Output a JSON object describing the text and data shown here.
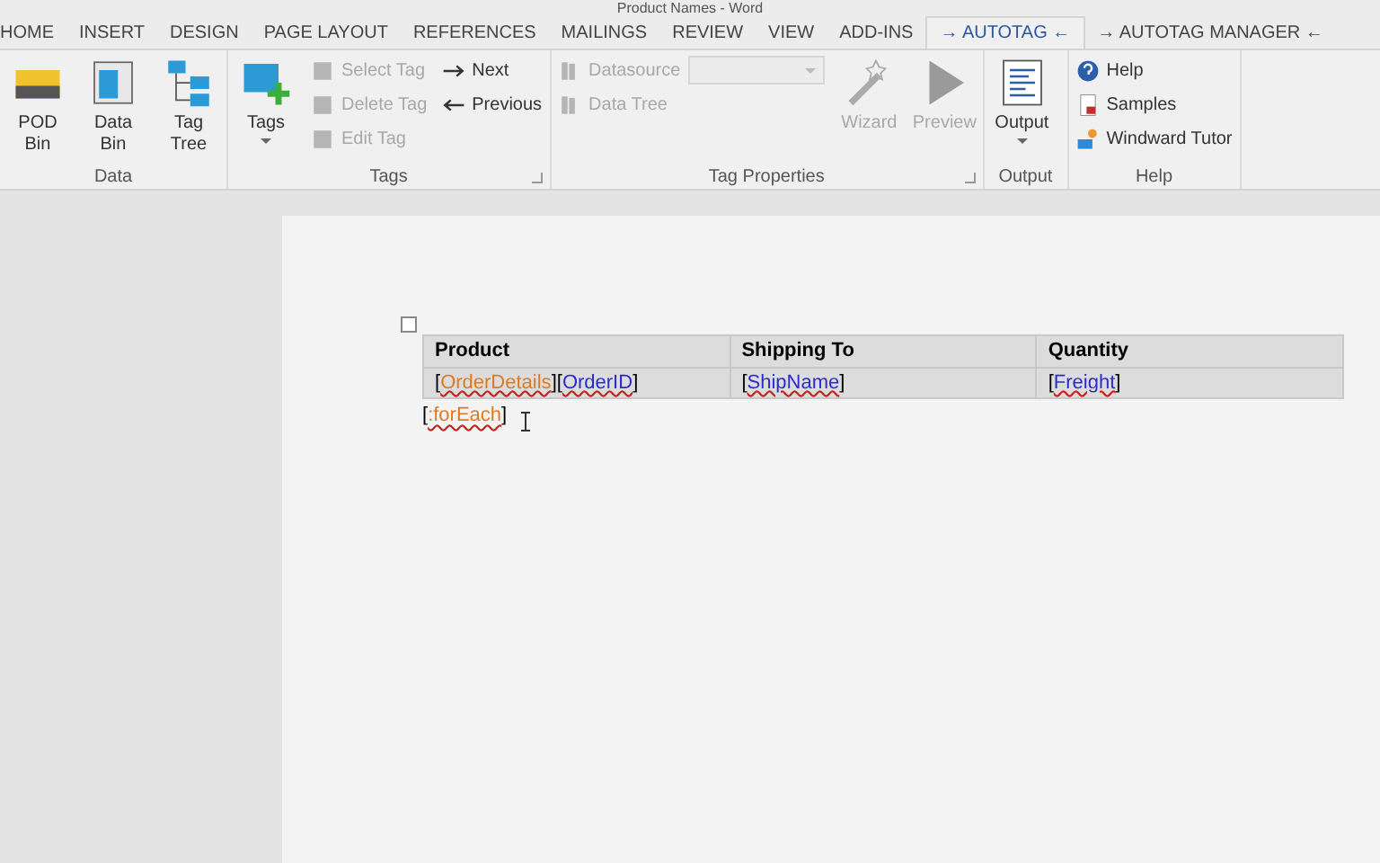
{
  "window": {
    "title": "Product Names - Word"
  },
  "tabs": [
    {
      "label": "HOME",
      "selected": false
    },
    {
      "label": "INSERT",
      "selected": false
    },
    {
      "label": "DESIGN",
      "selected": false
    },
    {
      "label": "PAGE LAYOUT",
      "selected": false
    },
    {
      "label": "REFERENCES",
      "selected": false
    },
    {
      "label": "MAILINGS",
      "selected": false
    },
    {
      "label": "REVIEW",
      "selected": false
    },
    {
      "label": "VIEW",
      "selected": false
    },
    {
      "label": "ADD-INS",
      "selected": false
    },
    {
      "label": "→ AUTOTAG ←",
      "selected": true
    },
    {
      "label": "→ AUTOTAG MANAGER ←",
      "selected": false
    }
  ],
  "ribbon": {
    "groups": [
      {
        "label": "Data",
        "launcher": false,
        "items": [
          {
            "kind": "large",
            "label": "POD Bin",
            "disabled": false,
            "dropdown": false
          },
          {
            "kind": "large",
            "label": "Data Bin",
            "disabled": false,
            "dropdown": false
          },
          {
            "kind": "large",
            "label": "Tag Tree",
            "disabled": false,
            "dropdown": false
          }
        ]
      },
      {
        "label": "Tags",
        "launcher": true,
        "items": [
          {
            "kind": "large",
            "label": "Tags",
            "disabled": false,
            "dropdown": true
          },
          {
            "kind": "stack",
            "items": [
              {
                "label": "Select Tag",
                "disabled": true
              },
              {
                "label": "Delete Tag",
                "disabled": true
              },
              {
                "label": "Edit Tag",
                "disabled": true
              }
            ]
          },
          {
            "kind": "stack",
            "items": [
              {
                "label": "Next",
                "disabled": false
              },
              {
                "label": "Previous",
                "disabled": false
              }
            ]
          }
        ]
      },
      {
        "label": "Tag Properties",
        "launcher": true,
        "items": [
          {
            "kind": "stack",
            "items": [
              {
                "label": "Datasource",
                "disabled": true,
                "combo": true
              },
              {
                "label": "Data Tree",
                "disabled": true
              }
            ]
          },
          {
            "kind": "large",
            "label": "Wizard",
            "disabled": true,
            "dropdown": false
          },
          {
            "kind": "large",
            "label": "Preview",
            "disabled": true,
            "dropdown": false
          }
        ]
      },
      {
        "label": "Output",
        "launcher": false,
        "items": [
          {
            "kind": "large",
            "label": "Output",
            "disabled": false,
            "dropdown": true
          }
        ]
      },
      {
        "label": "Help",
        "launcher": false,
        "items": [
          {
            "kind": "stack",
            "items": [
              {
                "label": "Help",
                "disabled": false
              },
              {
                "label": "Samples",
                "disabled": false
              },
              {
                "label": "Windward Tutor",
                "disabled": false
              }
            ]
          }
        ]
      }
    ]
  },
  "document": {
    "table": {
      "columns": [
        "Product",
        "Shipping To",
        "Quantity"
      ],
      "rows": [
        [
          [
            {
              "open": "[",
              "name": "OrderDetails",
              "close": "]",
              "color": "#e07a1f"
            },
            {
              "open": "[",
              "name": "OrderID",
              "close": "]",
              "color": "#2a2ad0"
            }
          ],
          [
            {
              "open": "[",
              "name": "ShipName",
              "close": "]",
              "color": "#2a2ad0"
            }
          ],
          [
            {
              "open": "[",
              "name": "Freight",
              "close": "]",
              "color": "#2a2ad0"
            }
          ]
        ]
      ]
    },
    "after_table": [
      {
        "open": "[",
        "name": ":forEach",
        "close": "]",
        "color": "#e07a1f"
      }
    ]
  }
}
